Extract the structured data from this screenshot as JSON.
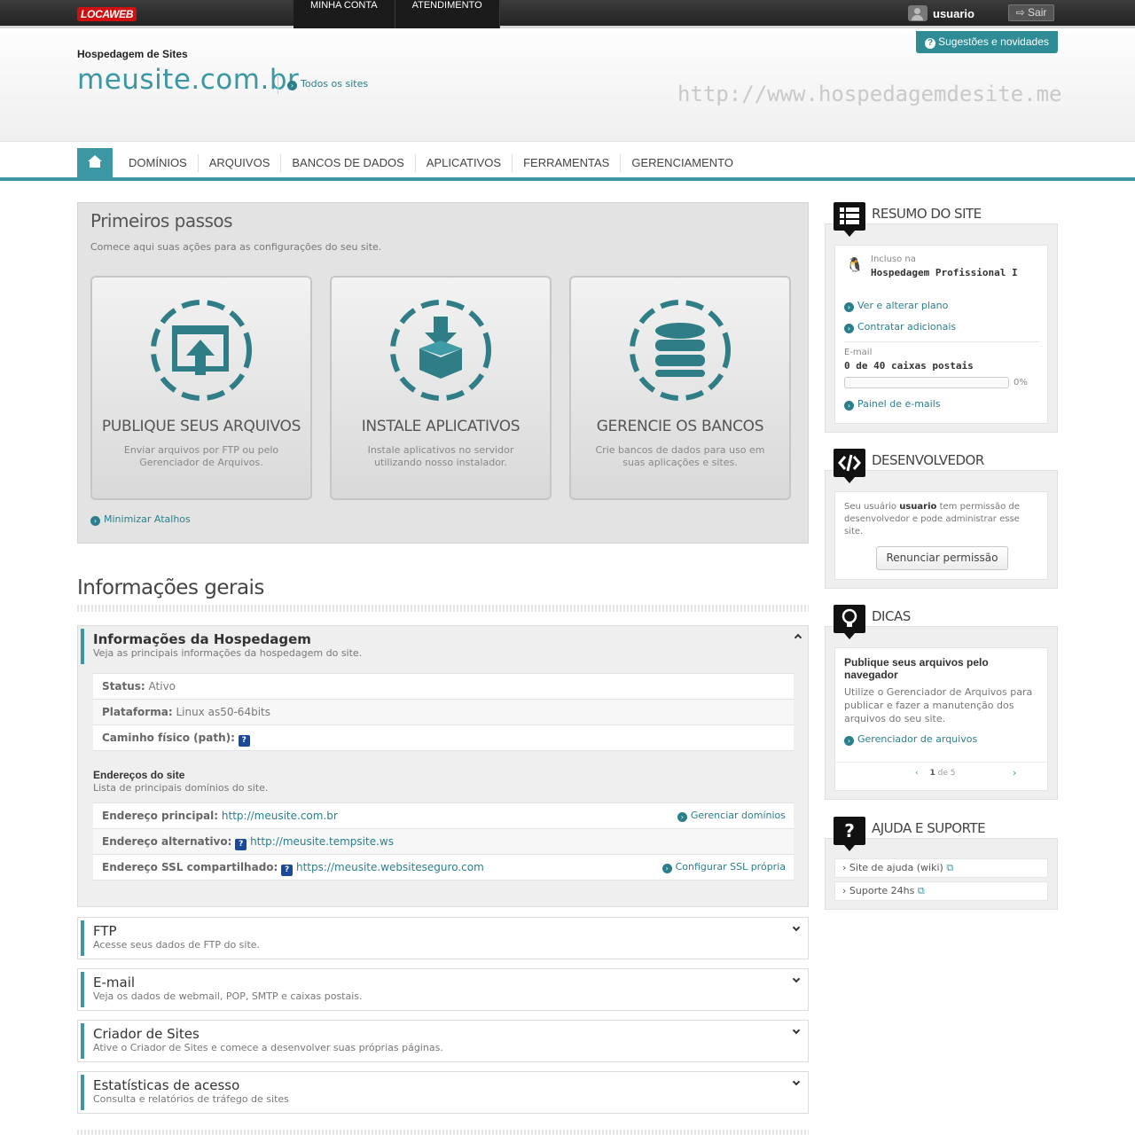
{
  "topbar": {
    "logo": "LOCAWEB",
    "nav": [
      "MINHA CONTA",
      "ATENDIMENTO"
    ],
    "username": "usuario",
    "logout": "Sair"
  },
  "header": {
    "suggestions": "Sugestões e novidades",
    "section_label": "Hospedagem de Sites",
    "site_name": "meusite.com.br",
    "all_sites": "Todos os sites",
    "watermark": "http://www.hospedagemdesite.me"
  },
  "nav": {
    "items": [
      "DOMÍNIOS",
      "ARQUIVOS",
      "BANCOS DE DADOS",
      "APLICATIVOS",
      "FERRAMENTAS",
      "GERENCIAMENTO"
    ]
  },
  "first_steps": {
    "title": "Primeiros passos",
    "subtitle": "Comece aqui suas ações para as configurações do seu site.",
    "cards": [
      {
        "title": "PUBLIQUE SEUS ARQUIVOS",
        "desc": "Enviar arquivos por FTP ou pelo Gerenciador de Arquivos.",
        "icon": "upload-icon"
      },
      {
        "title": "INSTALE APLICATIVOS",
        "desc": "Instale aplicativos no servidor utilizando nosso instalador.",
        "icon": "package-icon"
      },
      {
        "title": "GERENCIE OS BANCOS",
        "desc": "Crie bancos de dados para uso em suas aplicações e sites.",
        "icon": "database-icon"
      }
    ],
    "minimize": "Minimizar Atalhos"
  },
  "general": {
    "title": "Informações gerais",
    "hosting": {
      "title": "Informações da Hospedagem",
      "subtitle": "Veja as principais informações da hospedagem do site.",
      "rows": [
        {
          "label": "Status:",
          "value": "Ativo"
        },
        {
          "label": "Plataforma:",
          "value": "Linux as50-64bits"
        },
        {
          "label": "Caminho físico (path):",
          "value": "?"
        }
      ],
      "addresses_title": "Endereços do site",
      "addresses_sub": "Lista de principais domínios do site.",
      "addresses": [
        {
          "label": "Endereço principal:",
          "value": "http://meusite.com.br",
          "action": "Gerenciar domínios"
        },
        {
          "label": "Endereço alternativo:",
          "value": "http://meusite.tempsite.ws",
          "action": ""
        },
        {
          "label": "Endereço SSL compartilhado:",
          "value": "https://meusite.websiteseguro.com",
          "action": "Configurar SSL própria"
        }
      ]
    },
    "sections": [
      {
        "title": "FTP",
        "desc": "Acesse seus dados de FTP do site."
      },
      {
        "title": "E-mail",
        "desc": "Veja os dados de webmail, POP, SMTP e caixas postais."
      },
      {
        "title": "Criador de Sites",
        "desc": "Ative o Criador de Sites e comece a desenvolver suas próprias páginas."
      },
      {
        "title": "Estatísticas de acesso",
        "desc": "Consulta e relatórios de tráfego de sites"
      }
    ]
  },
  "sidebar": {
    "summary": {
      "title": "RESUMO DO SITE",
      "included_label": "Incluso na",
      "plan": "Hospedagem Profissional I",
      "link1": "Ver e alterar plano",
      "link2": "Contratar adicionais",
      "email_label": "E-mail",
      "email_count": "0 de 40 caixas postais",
      "percent": "0%",
      "email_progress": 0,
      "email_panel": "Painel de e-mails"
    },
    "developer": {
      "title": "DESENVOLVEDOR",
      "text_pre": "Seu usuário",
      "user": "usuario",
      "text_post": "tem permissão de desenvolvedor e pode administrar esse site.",
      "button": "Renunciar permissão"
    },
    "tips": {
      "title": "DICAS",
      "tip_title": "Publique seus arquivos pelo navegador",
      "tip_text": "Utilize o Gerenciador de Arquivos para publicar e fazer a manutenção dos arquivos do seu site.",
      "tip_link": "Gerenciador de arquivos",
      "page_current": "1",
      "page_of": "de",
      "page_total": "5"
    },
    "help": {
      "title": "AJUDA E SUPORTE",
      "items": [
        "Site de ajuda (wiki)",
        "Suporte 24hs"
      ]
    }
  },
  "colors": {
    "accent": "#3a97a3",
    "link": "#2a7f8a",
    "question": "#1c4a9b"
  }
}
